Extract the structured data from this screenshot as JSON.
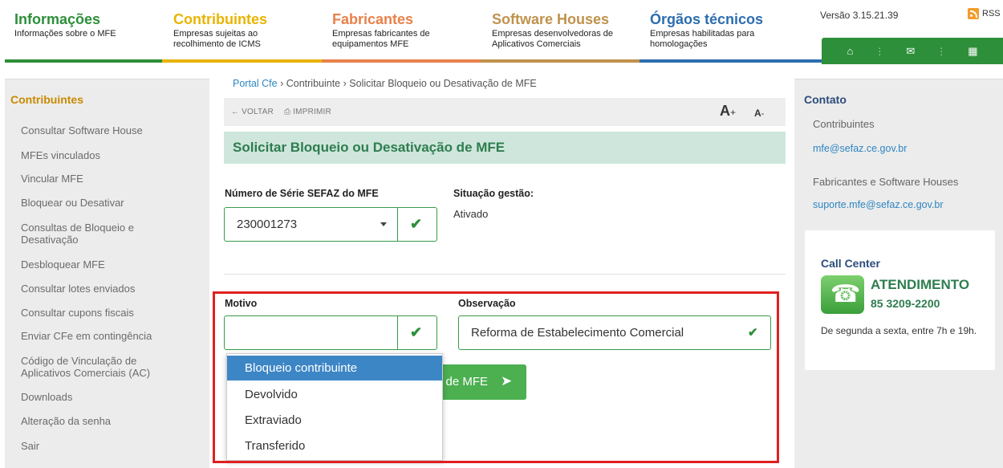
{
  "topnav": {
    "sections": [
      {
        "title": "Informações",
        "desc": "Informações sobre o MFE",
        "color": "#2d8f3a"
      },
      {
        "title": "Contribuintes",
        "desc": "Empresas sujeitas ao recolhimento de ICMS",
        "color": "#e8b400"
      },
      {
        "title": "Fabricantes",
        "desc": "Empresas fabricantes de equipamentos MFE",
        "color": "#e8814a"
      },
      {
        "title": "Software Houses",
        "desc": "Empresas desenvolvedoras de Aplicativos Comerciais",
        "color": "#c0924c"
      },
      {
        "title": "Órgãos técnicos",
        "desc": "Empresas habilitadas para homologações",
        "color": "#2c6db0"
      }
    ],
    "version": "Versão 3.15.21.39",
    "rss": "RSS",
    "icons": [
      "home-icon",
      "mail-icon",
      "sitemap-icon"
    ]
  },
  "sidebar": {
    "title": "Contribuintes",
    "items": [
      "Consultar Software House",
      "MFEs vinculados",
      "Vincular MFE",
      "Bloquear ou Desativar",
      "Consultas de Bloqueio e Desativação",
      "Desbloquear MFE",
      "Consultar lotes enviados",
      "Consultar cupons fiscais",
      "Enviar CFe em contingência",
      "Código de Vinculação de Aplicativos Comerciais (AC)",
      "Downloads",
      "Alteração da senha",
      "Sair"
    ]
  },
  "breadcrumb": {
    "home": "Portal Cfe",
    "sep": "›",
    "section": "Contribuinte",
    "current": "Solicitar Bloqueio ou Desativação de MFE"
  },
  "toolbar": {
    "back": "← VOLTAR",
    "print": "IMPRIMIR",
    "font_up": "A",
    "font_up_sign": "+",
    "font_down": "A",
    "font_down_sign": "-"
  },
  "form": {
    "title": "Solicitar Bloqueio ou Desativação de MFE",
    "serie_label": "Número de Série SEFAZ do MFE",
    "serie_value": "230001273",
    "situacao_label": "Situação gestão:",
    "situacao_value": "Ativado",
    "motivo_label": "Motivo",
    "motivo_value": "",
    "obs_label": "Observação",
    "obs_value": "Reforma de Estabelecimento Comercial",
    "submit_label": "o de MFE",
    "motivo_options": [
      "Bloqueio contribuinte",
      "Devolvido",
      "Extraviado",
      "Transferido"
    ],
    "selected_option": "Bloqueio contribuinte"
  },
  "contact": {
    "title": "Contato",
    "contrib_label": "Contribuintes",
    "contrib_email": "mfe@sefaz.ce.gov.br",
    "fab_label": "Fabricantes e Software Houses",
    "fab_email": "suporte.mfe@sefaz.ce.gov.br"
  },
  "callcenter": {
    "title": "Call Center",
    "atendimento": "ATENDIMENTO",
    "phone": "85 3209-2200",
    "hours": "De segunda a sexta, entre 7h e 19h."
  },
  "colors": {
    "accent_green": "#2d8f3a",
    "title_bar": "#cfe6dc",
    "dropdown_selected": "#3d86c6",
    "highlight_border": "#e02020"
  }
}
